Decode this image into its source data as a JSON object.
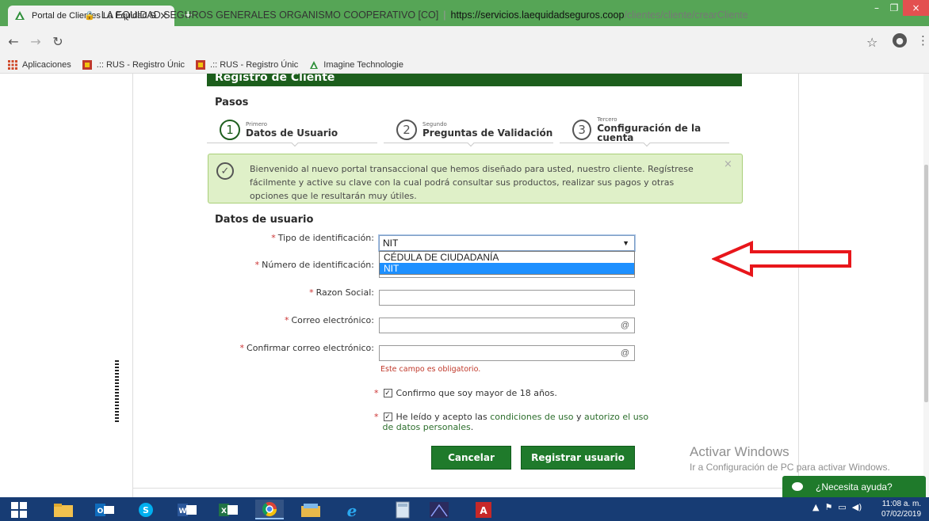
{
  "browser": {
    "tab_title": "Portal de Clientes La Equidad Seguros",
    "tab_close": "×",
    "new_tab": "+",
    "win_min": "–",
    "win_max": "❐",
    "win_close": "×",
    "site_name": "LA EQUIDAD SEGUROS GENERALES ORGANISMO COOPERATIVO [CO]",
    "separator": "|",
    "url_host": "https://servicios.laequidadseguros.coop",
    "url_path": "/clientes/cliente/crearCliente",
    "bookmarks": [
      {
        "label": "Aplicaciones",
        "icon": "apps-grid-icon"
      },
      {
        "label": ".:: RUS - Registro Únic",
        "icon": "rus-icon"
      },
      {
        "label": ".:: RUS - Registro Únic",
        "icon": "rus-icon"
      },
      {
        "label": "Imagine Technologie",
        "icon": "equidad-logo-icon"
      }
    ]
  },
  "page": {
    "header": "Registro de Cliente",
    "steps_title": "Pasos",
    "steps": [
      {
        "num": "1",
        "ordinal": "Primero",
        "name": "Datos de Usuario"
      },
      {
        "num": "2",
        "ordinal": "Segundo",
        "name": "Preguntas de Validación"
      },
      {
        "num": "3",
        "ordinal": "Tercero",
        "name": "Configuración de la cuenta"
      }
    ],
    "alert": {
      "text": "Bienvenido al nuevo portal transaccional que hemos diseñado para usted, nuestro cliente. Regístrese fácilmente y active su clave con la cual podrá consultar sus productos, realizar sus pagos y otras opciones que le resultarán muy útiles.",
      "close": "×",
      "check": "✓"
    },
    "section_title": "Datos de usuario",
    "required_mark": "*",
    "form": {
      "tipo_label": "Tipo de identificación:",
      "tipo_value": "NIT",
      "tipo_options": [
        "CÉDULA DE CIUDADANÍA",
        "NIT"
      ],
      "numero_label": "Número de identificación:",
      "razon_label": "Razon Social:",
      "correo_label": "Correo electrónico:",
      "confirmar_label": "Confirmar correo electrónico:",
      "at_symbol": "@",
      "error_msg": "Este campo es obligatorio.",
      "check_age": "Confirmo que soy mayor de 18 años.",
      "terms_prefix": "He leído y acepto las",
      "terms_link": "condiciones de uso",
      "terms_and": "y",
      "terms_link2": "autorizo el uso",
      "terms_link3": "de datos personales",
      "terms_end": ".",
      "checkmark": "✓",
      "cancel_label": "Cancelar",
      "submit_label": "Registrar usuario"
    },
    "help_label": "¿Necesita ayuda?"
  },
  "os": {
    "watermark_title": "Activar Windows",
    "watermark_sub": "Ir a Configuración de PC para activar Windows.",
    "time": "11:08 a. m.",
    "date": "07/02/2019",
    "taskbar_apps": [
      "start",
      "explorer",
      "outlook",
      "skype",
      "word",
      "excel",
      "chrome",
      "folder",
      "ie",
      "calculator",
      "media",
      "acrobat"
    ]
  },
  "colors": {
    "brand_green": "#1f7a2b",
    "chrome_green": "#56a556",
    "arrow_red": "#e8161b",
    "taskbar": "#173c74"
  }
}
